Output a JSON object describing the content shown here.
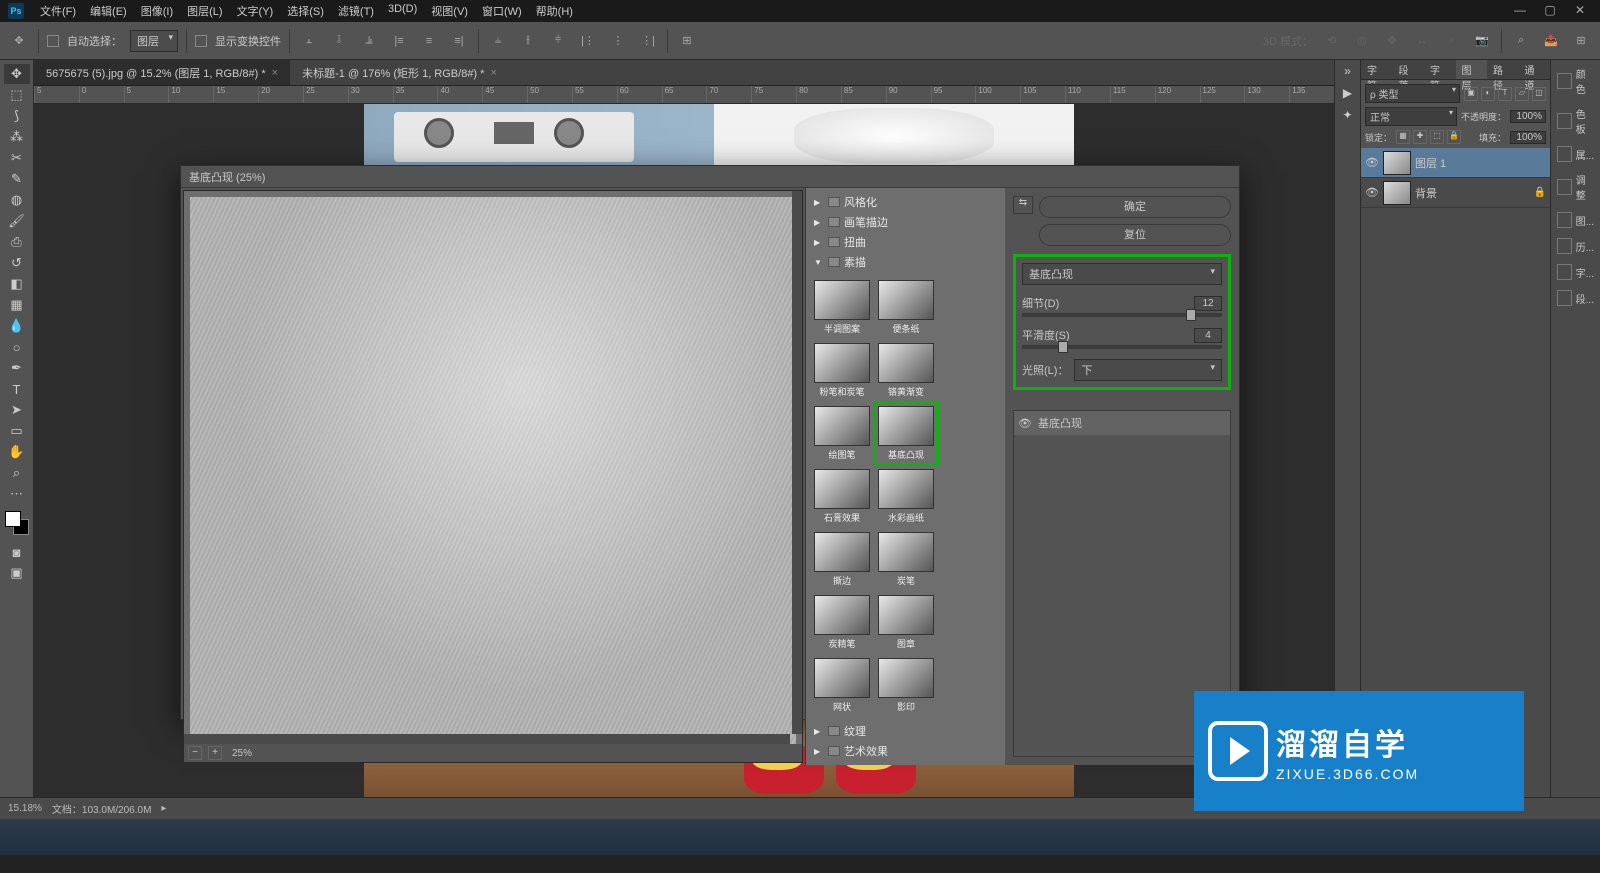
{
  "titlebar": {
    "app": "Ps"
  },
  "menu": [
    "文件(F)",
    "编辑(E)",
    "图像(I)",
    "图层(L)",
    "文字(Y)",
    "选择(S)",
    "滤镜(T)",
    "3D(D)",
    "视图(V)",
    "窗口(W)",
    "帮助(H)"
  ],
  "optbar": {
    "auto_select_label": "自动选择：",
    "auto_select_target": "图层",
    "show_transform": "显示变换控件",
    "mode3d_label": "3D 模式："
  },
  "tabs": [
    {
      "label": "5675675 (5).jpg @ 15.2% (图层 1, RGB/8#) *",
      "active": true
    },
    {
      "label": "未标题-1 @ 176% (矩形 1, RGB/8#) *",
      "active": false
    }
  ],
  "ruler_marks": [
    "5",
    "0",
    "5",
    "10",
    "15",
    "20",
    "25",
    "30",
    "35",
    "40",
    "45",
    "50",
    "55",
    "60",
    "65",
    "70",
    "75",
    "80",
    "85",
    "90",
    "95",
    "100",
    "105",
    "110",
    "115",
    "120",
    "125",
    "130",
    "135"
  ],
  "dialog": {
    "title": "基底凸现 (25%)",
    "zoom": "25%",
    "categories_closed": [
      "风格化",
      "画笔描边",
      "扭曲"
    ],
    "category_open": "素描",
    "thumbs": [
      {
        "label": "半调图案"
      },
      {
        "label": "便条纸"
      },
      {
        "label": "粉笔和炭笔"
      },
      {
        "label": "铬黄渐变"
      },
      {
        "label": "绘图笔"
      },
      {
        "label": "基底凸现",
        "sel": true
      },
      {
        "label": "石膏效果"
      },
      {
        "label": "水彩画纸"
      },
      {
        "label": "撕边"
      },
      {
        "label": "炭笔"
      },
      {
        "label": "炭精笔"
      },
      {
        "label": "图章"
      },
      {
        "label": "网状"
      },
      {
        "label": "影印"
      }
    ],
    "categories_after": [
      "纹理",
      "艺术效果"
    ],
    "ok": "确定",
    "reset": "复位",
    "settings": {
      "filter_name": "基底凸现",
      "detail_label": "细节(D)",
      "detail_value": "12",
      "smooth_label": "平滑度(S)",
      "smooth_value": "4",
      "light_label": "光照(L)：",
      "light_value": "下"
    },
    "applied": {
      "label": "基底凸现"
    }
  },
  "right_panels": {
    "strip": [
      "颜色",
      "色板",
      "属...",
      "调整",
      "图...",
      "历...",
      "字...",
      "段..."
    ],
    "layer_tabs": [
      "字符",
      "段落",
      "字符",
      "图层",
      "路径",
      "通道"
    ],
    "kind_label": "ρ 类型",
    "blend": "正常",
    "opacity_label": "不透明度：",
    "opacity_value": "100%",
    "lock_label": "锁定：",
    "fill_label": "填充：",
    "fill_value": "100%",
    "layers": [
      {
        "name": "图层 1",
        "sel": true,
        "locked": false
      },
      {
        "name": "背景",
        "sel": false,
        "locked": true
      }
    ]
  },
  "statusbar": {
    "zoom": "15.18%",
    "doc": "文档：103.0M/206.0M"
  },
  "watermark": {
    "title": "溜溜自学",
    "url": "ZIXUE.3D66.COM"
  }
}
